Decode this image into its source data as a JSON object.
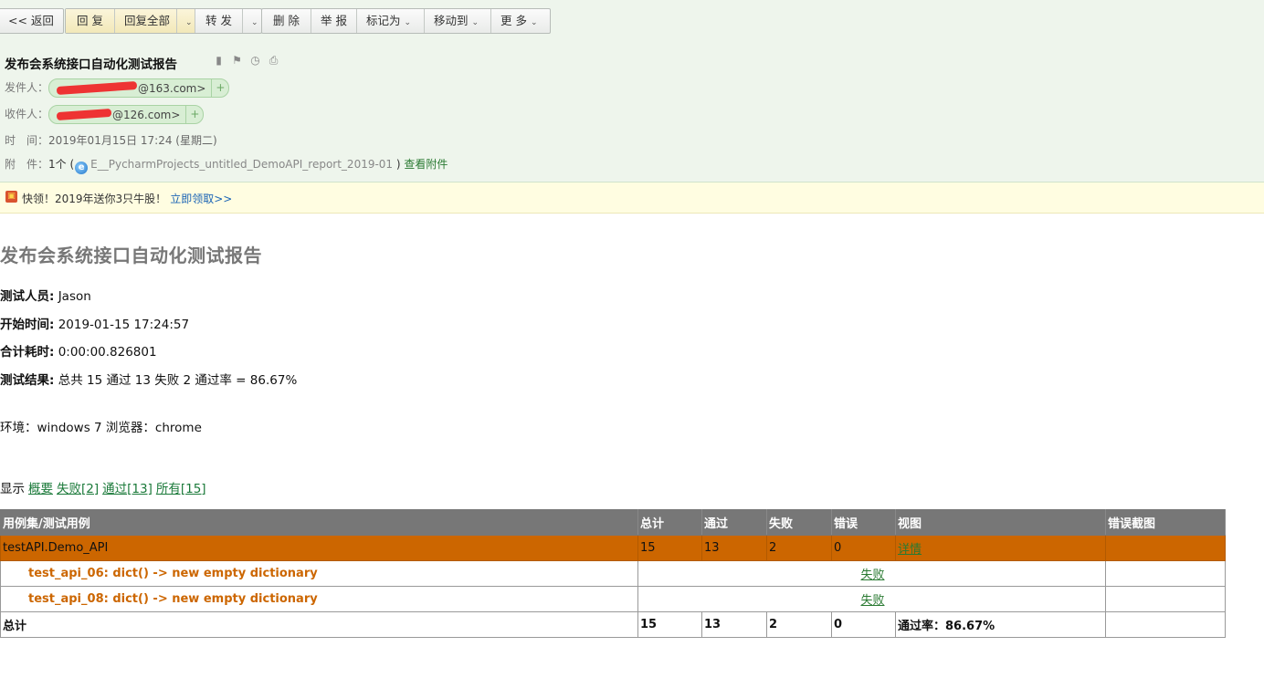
{
  "toolbar": {
    "back": "<< 返回",
    "reply": "回 复",
    "reply_all": "回复全部",
    "forward": "转 发",
    "delete": "删 除",
    "report": "举 报",
    "mark_as": "标记为",
    "move_to": "移动到",
    "more": "更 多"
  },
  "mail": {
    "subject": "发布会系统接口自动化测试报告",
    "from_label": "发件人：",
    "from_addr": "@163.com>",
    "to_label": "收件人：",
    "to_addr": "@126.com>",
    "time_label": "时　间：",
    "time_value": "2019年01月15日 17:24 (星期二)",
    "att_label": "附　件：",
    "att_count": "1个 (",
    "att_name": "E__PycharmProjects_untitled_DemoAPI_report_2019-01",
    "att_close": ")",
    "att_view": "查看附件"
  },
  "promo": {
    "text": "快领！2019年送你3只牛股！",
    "link": "立即领取>>"
  },
  "report": {
    "title": "发布会系统接口自动化测试报告",
    "tester_label": "测试人员:",
    "tester": "Jason",
    "start_label": "开始时间:",
    "start": "2019-01-15 17:24:57",
    "duration_label": "合计耗时:",
    "duration": "0:00:00.826801",
    "result_label": "测试结果:",
    "result": "总共 15 通过 13 失败 2 通过率 = 86.67%",
    "env": "环境：windows 7 浏览器：chrome",
    "filter_label": "显示",
    "filters": [
      "概要",
      "失败[2]",
      "通过[13]",
      "所有[15]"
    ]
  },
  "table": {
    "headers": [
      "用例集/测试用例",
      "总计",
      "通过",
      "失败",
      "错误",
      "视图",
      "错误截图"
    ],
    "suite": {
      "name": "testAPI.Demo_API",
      "total": "15",
      "pass": "13",
      "fail": "2",
      "error": "0",
      "view": "详情"
    },
    "cases": [
      {
        "name": "test_api_06: dict() -> new empty dictionary",
        "status": "失败"
      },
      {
        "name": "test_api_08: dict() -> new empty dictionary",
        "status": "失败"
      }
    ],
    "total": {
      "label": "总计",
      "total": "15",
      "pass": "13",
      "fail": "2",
      "error": "0",
      "rate": "通过率：86.67%"
    }
  },
  "colors": {
    "suite_row": "#cc6600",
    "header_row": "#777777",
    "link_green": "#2a7a32",
    "mail_head_bg": "#eef5ec"
  }
}
